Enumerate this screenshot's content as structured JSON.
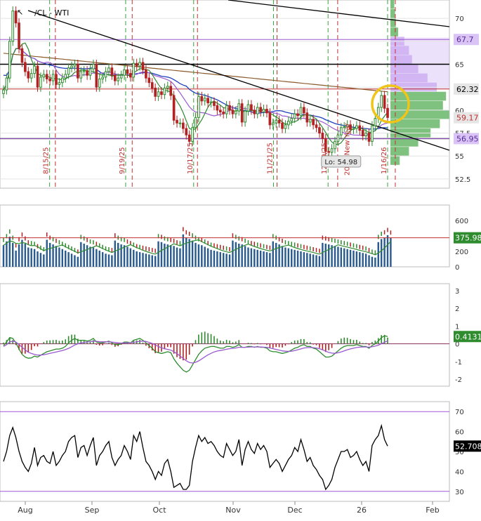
{
  "symbol": "/CL - WTI",
  "colors": {
    "up": "#2e8b2e",
    "down": "#b22222",
    "ma_blue": "#1f3fbf",
    "ma_brown": "#8b5a2b",
    "ma_purple": "#9b59d0",
    "ma_green": "#2e8b2e",
    "volume_bar": "#2a5b8f",
    "rsi_line": "#000000",
    "guide_purple": "#9b59d0",
    "highlight_circle": "#f0c419",
    "vp_green": "#5fb35f",
    "vp_purple": "#c9a8f0"
  },
  "chart_data": [
    {
      "type": "line",
      "panel": "price",
      "title": "/CL - WTI",
      "ylim": [
        51.5,
        72
      ],
      "yticks": [
        "52.5",
        "55",
        "57.5",
        "60",
        "62.5",
        "65",
        "67.5",
        "70"
      ],
      "close": [
        62.2,
        63.5,
        67.5,
        70.8,
        69.5,
        66.7,
        65.2,
        64.2,
        63.5,
        64.0,
        64.8,
        62.5,
        63.6,
        63.9,
        63.4,
        63.2,
        63.9,
        62.8,
        63.0,
        63.5,
        63.9,
        64.6,
        64.8,
        65.0,
        63.5,
        64.2,
        64.3,
        63.8,
        64.5,
        65.0,
        62.5,
        63.4,
        63.6,
        64.2,
        64.6,
        63.8,
        63.2,
        63.5,
        63.8,
        64.4,
        64.0,
        63.6,
        65.1,
        64.8,
        65.2,
        64.4,
        63.5,
        63.0,
        62.4,
        61.5,
        62.0,
        61.7,
        62.4,
        62.6,
        61.6,
        58.9,
        58.6,
        58.6,
        58.0,
        57.3,
        56.6,
        58.1,
        59.2,
        61.5,
        61.0,
        61.3,
        60.8,
        60.9,
        60.5,
        60.0,
        59.8,
        59.6,
        60.5,
        60.0,
        59.6,
        59.9,
        60.7,
        58.7,
        59.9,
        60.6,
        60.0,
        59.6,
        60.3,
        59.8,
        60.1,
        59.7,
        58.4,
        58.6,
        58.9,
        58.6,
        58.0,
        58.4,
        58.8,
        59.1,
        59.6,
        59.4,
        60.3,
        59.7,
        58.7,
        59.0,
        58.4,
        58.1,
        57.5,
        56.9,
        55.5,
        55.4,
        55.8,
        56.6,
        57.3,
        58.1,
        58.2,
        58.4,
        57.9,
        58.0,
        58.3,
        57.8,
        57.2,
        57.5,
        56.6,
        58.3,
        59.1,
        60.3,
        61.6,
        60.2,
        59.2
      ],
      "x_months": [
        "Aug",
        "Sep",
        "Oct",
        "Nov",
        "Dec",
        "26",
        "Feb"
      ],
      "vertical_dates": [
        "8/15/25",
        "9/19/25",
        "10/17/25",
        "11/21/25",
        "12/19/25",
        "1/16/26"
      ],
      "labels": {
        "low": "Lo: 54.98",
        "h1": "67.7",
        "h2": "62.32",
        "last": "59.17",
        "h3": "56.95",
        "rotated": "2026 New Year"
      }
    },
    {
      "type": "bar",
      "panel": "volume",
      "ylim": [
        0,
        800
      ],
      "yticks": [
        "0",
        "200",
        "400",
        "600"
      ],
      "last": "375.98",
      "values": [
        280,
        330,
        390,
        310,
        210,
        290,
        350,
        300,
        250,
        240,
        230,
        200,
        180,
        160,
        350,
        310,
        290,
        270,
        250,
        230,
        210,
        190,
        170,
        150,
        130,
        320,
        300,
        280,
        260,
        250,
        230,
        210,
        190,
        170,
        160,
        150,
        340,
        310,
        290,
        280,
        260,
        240,
        220,
        200,
        190,
        180,
        170,
        160,
        150,
        140,
        330,
        320,
        300,
        290,
        280,
        270,
        250,
        240,
        420,
        380,
        360,
        340,
        310,
        290,
        280,
        260,
        240,
        220,
        210,
        200,
        190,
        180,
        170,
        160,
        340,
        320,
        300,
        290,
        270,
        250,
        240,
        230,
        220,
        210,
        200,
        190,
        180,
        330,
        310,
        290,
        270,
        250,
        240,
        230,
        220,
        210,
        200,
        190,
        180,
        170,
        160,
        150,
        140,
        310,
        300,
        290,
        280,
        270,
        260,
        250,
        240,
        230,
        220,
        210,
        200,
        190,
        180,
        170,
        150,
        130,
        120,
        320,
        360,
        380,
        410,
        376
      ]
    },
    {
      "type": "line",
      "panel": "macd",
      "ylim": [
        -2.4,
        3.4
      ],
      "yticks": [
        "-2",
        "-1",
        "0",
        "1",
        "2",
        "3"
      ],
      "last": "0.41314",
      "line": [
        -0.1,
        0.1,
        0.35,
        0.3,
        0.05,
        -0.3,
        -0.6,
        -0.75,
        -0.82,
        -0.8,
        -0.7,
        -0.75,
        -0.65,
        -0.55,
        -0.45,
        -0.4,
        -0.35,
        -0.3,
        -0.3,
        -0.25,
        -0.15,
        0.05,
        0.2,
        0.3,
        0.2,
        0.2,
        0.2,
        0.15,
        0.2,
        0.3,
        0.1,
        0.05,
        0.05,
        0.1,
        0.15,
        0.05,
        -0.05,
        -0.05,
        0.0,
        0.1,
        0.1,
        0.05,
        0.2,
        0.25,
        0.3,
        0.2,
        0.05,
        -0.1,
        -0.25,
        -0.45,
        -0.5,
        -0.55,
        -0.5,
        -0.45,
        -0.5,
        -0.85,
        -1.1,
        -1.3,
        -1.5,
        -1.6,
        -1.5,
        -1.2,
        -0.9,
        -0.6,
        -0.4,
        -0.25,
        -0.2,
        -0.15,
        -0.15,
        -0.2,
        -0.25,
        -0.25,
        -0.15,
        -0.15,
        -0.2,
        -0.15,
        -0.05,
        -0.2,
        -0.2,
        -0.15,
        -0.15,
        -0.2,
        -0.15,
        -0.2,
        -0.2,
        -0.25,
        -0.4,
        -0.45,
        -0.45,
        -0.5,
        -0.55,
        -0.5,
        -0.45,
        -0.35,
        -0.25,
        -0.2,
        -0.1,
        -0.05,
        -0.15,
        -0.15,
        -0.25,
        -0.3,
        -0.45,
        -0.6,
        -0.75,
        -0.75,
        -0.7,
        -0.55,
        -0.4,
        -0.25,
        -0.15,
        -0.1,
        -0.1,
        -0.1,
        -0.05,
        -0.1,
        -0.15,
        -0.15,
        -0.25,
        -0.1,
        0.0,
        0.15,
        0.35,
        0.45,
        0.41
      ],
      "signal": [
        -0.15,
        -0.05,
        0.1,
        0.15,
        0.1,
        -0.05,
        -0.2,
        -0.35,
        -0.48,
        -0.55,
        -0.6,
        -0.64,
        -0.64,
        -0.62,
        -0.58,
        -0.54,
        -0.5,
        -0.46,
        -0.42,
        -0.38,
        -0.33,
        -0.26,
        -0.17,
        -0.07,
        0.0,
        0.05,
        0.08,
        0.1,
        0.12,
        0.15,
        0.14,
        0.12,
        0.11,
        0.11,
        0.11,
        0.1,
        0.07,
        0.05,
        0.04,
        0.05,
        0.06,
        0.06,
        0.08,
        0.11,
        0.14,
        0.15,
        0.13,
        0.08,
        0.02,
        -0.07,
        -0.15,
        -0.23,
        -0.28,
        -0.32,
        -0.36,
        -0.45,
        -0.56,
        -0.69,
        -0.83,
        -0.96,
        -1.06,
        -1.09,
        -1.05,
        -0.97,
        -0.86,
        -0.74,
        -0.63,
        -0.54,
        -0.46,
        -0.41,
        -0.38,
        -0.35,
        -0.31,
        -0.28,
        -0.26,
        -0.24,
        -0.2,
        -0.2,
        -0.2,
        -0.19,
        -0.18,
        -0.18,
        -0.18,
        -0.18,
        -0.19,
        -0.2,
        -0.24,
        -0.28,
        -0.32,
        -0.36,
        -0.4,
        -0.42,
        -0.43,
        -0.42,
        -0.38,
        -0.34,
        -0.29,
        -0.24,
        -0.22,
        -0.21,
        -0.22,
        -0.24,
        -0.28,
        -0.34,
        -0.42,
        -0.49,
        -0.53,
        -0.54,
        -0.51,
        -0.46,
        -0.4,
        -0.34,
        -0.29,
        -0.25,
        -0.21,
        -0.19,
        -0.18,
        -0.18,
        -0.19,
        -0.17,
        -0.13,
        -0.08,
        0.0,
        0.09,
        0.16
      ]
    },
    {
      "type": "line",
      "panel": "rsi",
      "ylim": [
        25,
        75
      ],
      "yticks": [
        "30",
        "40",
        "50",
        "60",
        "70"
      ],
      "guides": [
        70,
        30
      ],
      "last": "52.708",
      "values": [
        45,
        50,
        58,
        62,
        57,
        50,
        45,
        42,
        40,
        44,
        52,
        43,
        47,
        48,
        45,
        44,
        50,
        43,
        45,
        48,
        50,
        55,
        57,
        58,
        47,
        52,
        53,
        48,
        53,
        57,
        43,
        48,
        50,
        53,
        55,
        47,
        43,
        46,
        48,
        53,
        50,
        46,
        58,
        55,
        60,
        52,
        45,
        43,
        40,
        36,
        40,
        38,
        44,
        46,
        40,
        32,
        33,
        34,
        31,
        31,
        33,
        45,
        52,
        58,
        55,
        57,
        54,
        55,
        53,
        50,
        48,
        47,
        54,
        51,
        48,
        50,
        56,
        43,
        51,
        55,
        51,
        49,
        54,
        51,
        53,
        50,
        42,
        44,
        46,
        44,
        40,
        43,
        46,
        48,
        52,
        50,
        56,
        51,
        45,
        47,
        43,
        41,
        38,
        36,
        31,
        33,
        36,
        42,
        46,
        50,
        50,
        51,
        47,
        48,
        50,
        46,
        43,
        45,
        40,
        53,
        56,
        58,
        63,
        56,
        52.7
      ]
    }
  ]
}
